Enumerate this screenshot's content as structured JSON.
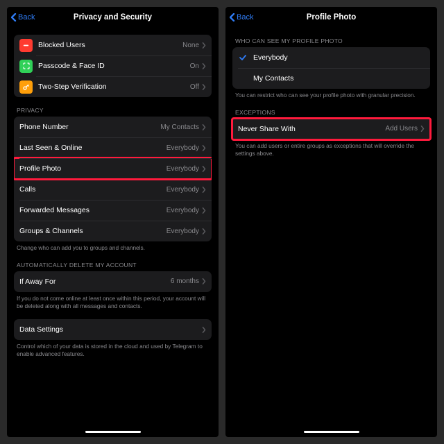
{
  "left": {
    "back": "Back",
    "title": "Privacy and Security",
    "top_rows": [
      {
        "label": "Blocked Users",
        "value": "None",
        "icon": "blocked"
      },
      {
        "label": "Passcode & Face ID",
        "value": "On",
        "icon": "passcode"
      },
      {
        "label": "Two-Step Verification",
        "value": "Off",
        "icon": "twostep"
      }
    ],
    "privacy_header": "PRIVACY",
    "privacy_rows": [
      {
        "label": "Phone Number",
        "value": "My Contacts"
      },
      {
        "label": "Last Seen & Online",
        "value": "Everybody"
      },
      {
        "label": "Profile Photo",
        "value": "Everybody",
        "highlight": true
      },
      {
        "label": "Calls",
        "value": "Everybody"
      },
      {
        "label": "Forwarded Messages",
        "value": "Everybody"
      },
      {
        "label": "Groups & Channels",
        "value": "Everybody"
      }
    ],
    "privacy_footer": "Change who can add you to groups and channels.",
    "auto_header": "AUTOMATICALLY DELETE MY ACCOUNT",
    "auto_row": {
      "label": "If Away For",
      "value": "6 months"
    },
    "auto_footer": "If you do not come online at least once within this period, your account will be deleted along with all messages and contacts.",
    "data_row": {
      "label": "Data Settings",
      "value": ""
    },
    "data_footer": "Control which of your data is stored in the cloud and used by Telegram to enable advanced features."
  },
  "right": {
    "back": "Back",
    "title": "Profile Photo",
    "who_header": "WHO CAN SEE MY PROFILE PHOTO",
    "options": [
      {
        "label": "Everybody",
        "checked": true
      },
      {
        "label": "My Contacts",
        "checked": false
      }
    ],
    "who_footer": "You can restrict who can see your profile photo with granular precision.",
    "exc_header": "EXCEPTIONS",
    "exc_row": {
      "label": "Never Share With",
      "value": "Add Users",
      "highlight": true
    },
    "exc_footer": "You can add users or entire groups as exceptions that will override the settings above."
  }
}
